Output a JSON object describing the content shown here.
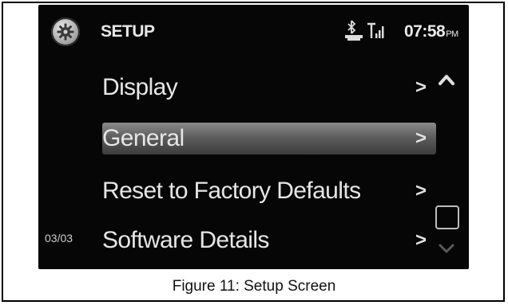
{
  "screen": {
    "title": "SETUP",
    "clock": {
      "time": "07:58",
      "ampm": "PM"
    },
    "status_icons": [
      "bluetooth-phone-icon",
      "signal-strength-icon"
    ],
    "menu": {
      "items": [
        {
          "label": "Display",
          "selected": false
        },
        {
          "label": "General",
          "selected": true
        },
        {
          "label": "Reset to Factory Defaults",
          "selected": false
        },
        {
          "label": "Software Details",
          "selected": false
        }
      ],
      "chevron": ">"
    },
    "page_indicator": "03/03",
    "scroll": {
      "up_icon": "chevron-up-icon",
      "down_icon": "chevron-down-icon"
    }
  },
  "caption": "Figure 11: Setup Screen",
  "colors": {
    "background": "#060606",
    "text": "#e6e6e6",
    "highlight": "#6e6e6e"
  }
}
